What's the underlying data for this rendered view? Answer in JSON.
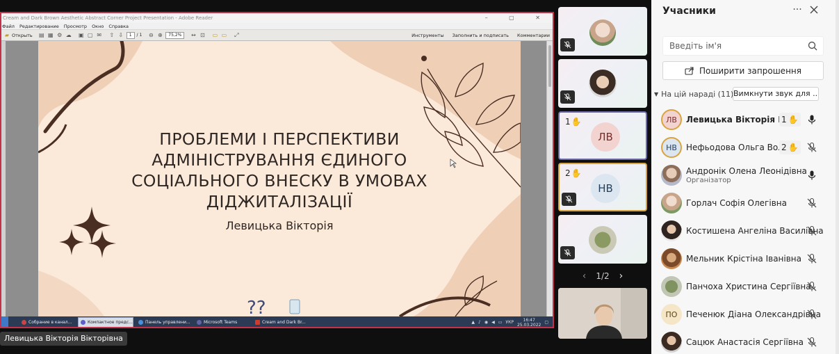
{
  "shared_window": {
    "title": "Cream and   Dark Brown Aesthetic Abstract Corner Project Presentation - Adobe Reader",
    "menu": [
      "Файл",
      "Редактирование",
      "Просмотр",
      "Окно",
      "Справка"
    ],
    "open_label": "Открыть",
    "page_number": "1",
    "page_total": "/ 1",
    "zoom": "75,2%",
    "toolbar_right": [
      "Инструменты",
      "Заполнить и подписать",
      "Комментарии"
    ]
  },
  "slide": {
    "title_lines": [
      "ПРОБЛЕМИ І ПЕРСПЕКТИВИ",
      "АДМІНІСТРУВАННЯ ЄДИНОГО",
      "СОЦІАЛЬНОГО ВНЕСКУ В УМОВАХ",
      "ДІДЖИТАЛІЗАЦІЇ"
    ],
    "author": "Левицька Вікторія",
    "accent_color": "#4a2e22",
    "shape_color": "#efd0b7"
  },
  "taskbar": {
    "items": [
      "Собрание в канал...",
      "Компактное предс...",
      "Панель управлени...",
      "Microsoft Teams",
      "Cream and   Dark Br..."
    ],
    "lang": "УКР",
    "time": "16:47",
    "date": "25.03.2022"
  },
  "speaker_label": "Левицька Вікторія Вікторівна",
  "gallery": {
    "tiles": [
      {
        "initials": "",
        "hand": ""
      },
      {
        "initials": "",
        "hand": ""
      },
      {
        "initials": "ЛВ",
        "hand": "1"
      },
      {
        "initials": "НВ",
        "hand": "2"
      },
      {
        "initials": "",
        "hand": ""
      }
    ],
    "pager": "1/2"
  },
  "panel": {
    "title": "Учасники",
    "search_placeholder": "Введіть ім'я",
    "invite_label": "Поширити запрошення",
    "section_label": "На цій нараді (11)",
    "mute_all_label": "Вимкнути звук для ...",
    "participants": [
      {
        "initials": "ЛВ",
        "name": "Левицька Вікторія Ві...",
        "role": "",
        "hand": "1",
        "mic": "on"
      },
      {
        "initials": "НВ",
        "name": "Нефьодова Ольга Вол...",
        "role": "",
        "hand": "2",
        "mic": "off"
      },
      {
        "initials": "",
        "name": "Андронік Олена Леонідівна",
        "role": "Організатор",
        "hand": "",
        "mic": "on"
      },
      {
        "initials": "",
        "name": "Горлач Софія Олегівна",
        "role": "",
        "hand": "",
        "mic": "off"
      },
      {
        "initials": "",
        "name": "Костишена Ангеліна Василівна",
        "role": "",
        "hand": "",
        "mic": "off"
      },
      {
        "initials": "",
        "name": "Мельник Крістіна Іванівна",
        "role": "",
        "hand": "",
        "mic": "off"
      },
      {
        "initials": "",
        "name": "Панчоха Христина Сергіївна",
        "role": "",
        "hand": "",
        "mic": "off"
      },
      {
        "initials": "ПО",
        "name": "Печенюк Діана Олександрівна",
        "role": "",
        "hand": "",
        "mic": "off"
      },
      {
        "initials": "",
        "name": "Сацюк Анастасія Сергіївна",
        "role": "",
        "hand": "",
        "mic": "off"
      }
    ]
  }
}
